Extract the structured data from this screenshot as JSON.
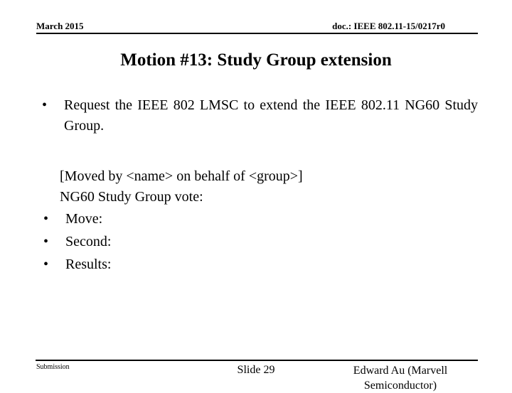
{
  "header": {
    "left": "March 2015",
    "right": "doc.: IEEE 802.11-15/0217r0"
  },
  "title": "Motion #13: Study Group extension",
  "content": {
    "bullet_symbol": "•",
    "motion_text": "Request the IEEE 802 LMSC to extend the IEEE 802.11 NG60 Study Group.",
    "moved_by_line": "[Moved by <name> on behalf of <group>]",
    "vote_header_line": "NG60 Study Group vote:",
    "vote_items": [
      {
        "label": "Move:"
      },
      {
        "label": "Second:"
      },
      {
        "label": "Results:"
      }
    ]
  },
  "footer": {
    "left": "Submission",
    "center": "Slide 29",
    "right_line1": "Edward Au (Marvell",
    "right_line2": "Semiconductor)"
  },
  "colors": {
    "text": "#000000",
    "background": "#ffffff",
    "rule": "#000000"
  }
}
